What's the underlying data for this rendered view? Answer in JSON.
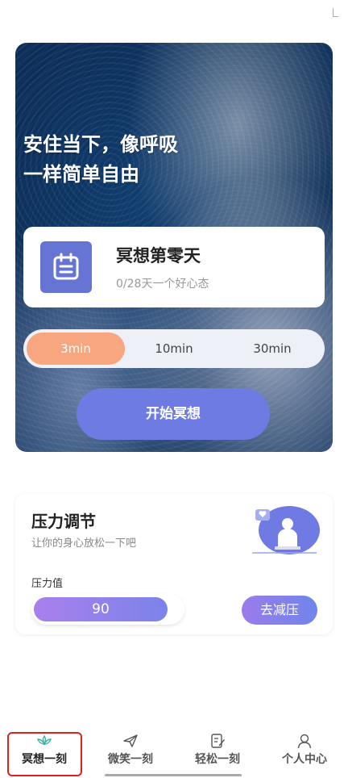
{
  "hero": {
    "title": "安住当下，像呼吸\n一样简单自由",
    "progress_title": "冥想第零天",
    "progress_subtitle": "0/28天一个好心态",
    "durations": [
      {
        "label": "3min",
        "selected": true
      },
      {
        "label": "10min",
        "selected": false
      },
      {
        "label": "30min",
        "selected": false
      }
    ],
    "start_label": "开始冥想"
  },
  "stress": {
    "title": "压力调节",
    "subtitle": "让你的身心放松一下吧",
    "value_label": "压力值",
    "value": "90",
    "value_fraction": 0.9,
    "action_label": "去减压"
  },
  "nav": {
    "items": [
      {
        "label": "冥想一刻",
        "icon": "lotus-icon",
        "active": true
      },
      {
        "label": "微笑一刻",
        "icon": "paper-plane-icon",
        "active": false
      },
      {
        "label": "轻松一刻",
        "icon": "edit-note-icon",
        "active": false
      },
      {
        "label": "个人中心",
        "icon": "person-icon",
        "active": false
      }
    ]
  },
  "colors": {
    "accent": "#6d7be2",
    "selected_duration": "#f8a680",
    "highlight": "#e02020",
    "nav_active_icon": "#3bb4a0"
  }
}
